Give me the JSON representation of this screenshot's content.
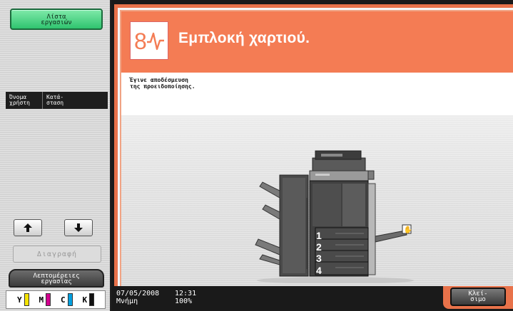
{
  "left_panel": {
    "job_list_label": "Λίστα\nεργασιών",
    "col_user_label": "Όνομα\nχρήστη",
    "col_status_label": "Κατά-\nσταση",
    "delete_label": "Διαγραφή",
    "details_label": "Λεπτομέρειες\nεργασίας",
    "toner": [
      {
        "letter": "Y",
        "color": "#f4e300"
      },
      {
        "letter": "M",
        "color": "#d3008f"
      },
      {
        "letter": "C",
        "color": "#00a0e0"
      },
      {
        "letter": "K",
        "color": "#111111"
      }
    ]
  },
  "main": {
    "title": "Εμπλοκή χαρτιού.",
    "message": "Έγινε αποδέσμευση\nτης προειδοποίησης.",
    "trays": [
      "1",
      "2",
      "3",
      "4"
    ],
    "accent_color": "#f47c54"
  },
  "status": {
    "date": "07/05/2008",
    "time": "12:31",
    "memory_label": "Μνήμη",
    "memory_value": "100%"
  },
  "close_label": "Κλεί-\nσιμο"
}
